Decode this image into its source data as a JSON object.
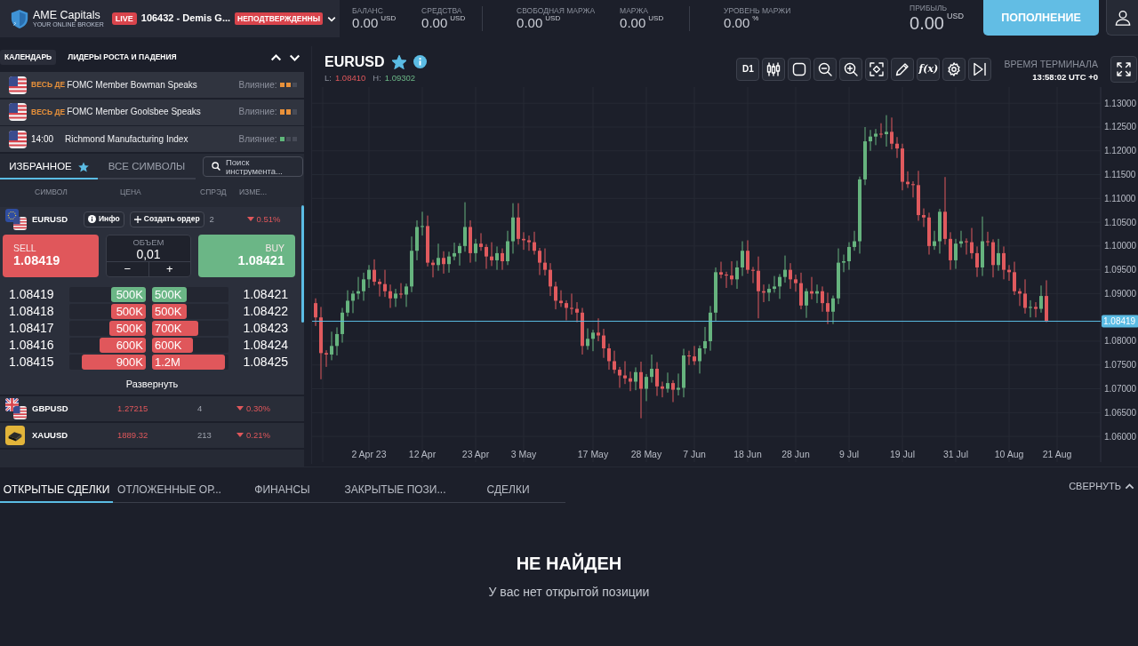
{
  "header": {
    "brand": "AME Capitals",
    "tagline": "YOUR ONLINE BROKER",
    "mode_badge": "LIVE",
    "account": "106432 - Demis G...",
    "status_badge": "НЕПОДТВЕРЖДЕННЫ"
  },
  "metrics": [
    {
      "kind": "stat",
      "label": "БАЛАНС",
      "value": "0.00",
      "unit": "USD"
    },
    {
      "kind": "stat",
      "label": "СРЕДСТВА",
      "value": "0.00",
      "unit": "USD"
    },
    {
      "kind": "stat",
      "label": "СВОБОДНАЯ МАРЖА",
      "value": "0.00",
      "unit": "USD"
    },
    {
      "kind": "stat",
      "label": "МАРЖА",
      "value": "0.00",
      "unit": "USD"
    },
    {
      "kind": "stat",
      "label": "УРОВЕНЬ МАРЖИ",
      "value": "0.00",
      "unit": "%"
    },
    {
      "kind": "total",
      "label": "ПРИБЫЛЬ",
      "value": "0.00",
      "unit": "USD"
    }
  ],
  "deposit_button": "ПОПОЛНЕНИЕ",
  "news_tabs": [
    {
      "label": "КАЛЕНДАРЬ",
      "selected": true
    },
    {
      "label": "ЛИДЕРЫ РОСТА И ПАДЕНИЯ",
      "selected": false
    }
  ],
  "calendar": [
    {
      "kind": "all_day",
      "time": "ВЕСЬ ДЕ",
      "title": "FOMC Member Bowman Speaks",
      "impact_label": "Влияние:",
      "stars": 2,
      "color": "#e8913a"
    },
    {
      "kind": "all_day",
      "time": "ВЕСЬ ДЕ",
      "title": "FOMC Member Goolsbee Speaks",
      "impact_label": "Влияние:",
      "stars": 2,
      "color": "#e8913a"
    },
    {
      "kind": "timed",
      "time": "14:00",
      "title": "Richmond Manufacturing Index",
      "impact_label": "Влияние:",
      "stars": 1,
      "color": "#5fb77a"
    }
  ],
  "symbol_tabs": [
    {
      "label": "ИЗБРАННОЕ",
      "selected": true
    },
    {
      "label": "ВСЕ СИМВОЛЫ",
      "selected": false
    }
  ],
  "search": {
    "placeholder": "Поиск инструмента..."
  },
  "columns": [
    "СИМВОЛ",
    "ЦЕНА",
    "СПРЭД",
    "ИЗМЕ..."
  ],
  "symbols": [
    {
      "symbol": "EURUSD",
      "expanded": true,
      "info_button": "Инфо",
      "order_button": "Создать ордер",
      "spread": "2",
      "change": "0.51%",
      "falling": true,
      "sell": {
        "label": "SELL",
        "price": "1.08419"
      },
      "volume": {
        "label": "ОБЪЕМ",
        "value": "0,01",
        "minus": "−",
        "plus": "+"
      },
      "buy": {
        "label": "BUY",
        "price": "1.08421"
      },
      "depth": [
        {
          "color": "#6bb686",
          "bid": {
            "price": "1.08419",
            "volume": "500K",
            "level": 0.45
          },
          "ask": {
            "price": "1.08421",
            "volume": "500K",
            "level": 0.45
          }
        },
        {
          "color": "#e0575b",
          "bid": {
            "price": "1.08418",
            "volume": "500K",
            "level": 0.45
          },
          "ask": {
            "price": "1.08422",
            "volume": "500K",
            "level": 0.45
          }
        },
        {
          "color": "#e0575b",
          "bid": {
            "price": "1.08417",
            "volume": "500K",
            "level": 0.48
          },
          "ask": {
            "price": "1.08423",
            "volume": "700K",
            "level": 0.6
          }
        },
        {
          "color": "#e0575b",
          "bid": {
            "price": "1.08416",
            "volume": "600K",
            "level": 0.6
          },
          "ask": {
            "price": "1.08424",
            "volume": "600K",
            "level": 0.54
          }
        },
        {
          "color": "#e0575b",
          "bid": {
            "price": "1.08415",
            "volume": "900K",
            "level": 0.84
          },
          "ask": {
            "price": "1.08425",
            "volume": "1.2M",
            "level": 0.95
          }
        }
      ],
      "expand_link": "Развернуть"
    },
    {
      "symbol": "GBPUSD",
      "expanded": false,
      "price": "1.27215",
      "spread": "4",
      "change": "0.30%",
      "falling": true
    },
    {
      "symbol": "XAUUSD",
      "expanded": false,
      "price": "1889.32",
      "spread": "213",
      "change": "0.21%",
      "falling": true
    }
  ],
  "chart": {
    "symbol": "EURUSD",
    "favorite": true,
    "low_label": "L:",
    "low": "1.08410",
    "high_label": "H:",
    "high": "1.09302",
    "timeframe": "D1",
    "indicator_button": "f(x)",
    "time_label": "ВРЕМЯ ТЕРМИНАЛА",
    "time": "13:58:02 UTC +0",
    "chart_data": {
      "type": "candlestick",
      "grid": true,
      "categories": [
        null,
        null,
        null,
        null,
        null,
        null,
        null,
        null,
        null,
        null,
        "2 Apr 23",
        null,
        null,
        null,
        null,
        null,
        null,
        null,
        null,
        null,
        "12 Apr",
        null,
        null,
        null,
        null,
        null,
        null,
        null,
        null,
        null,
        "23 Apr",
        null,
        null,
        null,
        null,
        null,
        null,
        null,
        null,
        "3 May",
        null,
        null,
        null,
        null,
        null,
        null,
        null,
        null,
        null,
        null,
        null,
        null,
        "17 May",
        null,
        null,
        null,
        null,
        null,
        null,
        null,
        null,
        null,
        "28 May",
        null,
        null,
        null,
        null,
        null,
        null,
        null,
        null,
        "7 Jun",
        null,
        null,
        null,
        null,
        null,
        null,
        null,
        null,
        null,
        "18 Jun",
        null,
        null,
        null,
        null,
        null,
        null,
        null,
        null,
        "28 Jun",
        null,
        null,
        null,
        null,
        null,
        null,
        null,
        null,
        null,
        "9 Jul",
        null,
        null,
        null,
        null,
        null,
        null,
        null,
        null,
        null,
        "19 Jul",
        null,
        null,
        null,
        null,
        null,
        null,
        null,
        null,
        null,
        "31 Jul",
        null,
        null,
        null,
        null,
        null,
        null,
        null,
        null,
        null,
        "10 Aug",
        null,
        null,
        null,
        null,
        null,
        null,
        null,
        null,
        "21 Aug"
      ],
      "ohlc": [
        [
          1.088,
          1.089,
          1.0832,
          1.085
        ],
        [
          1.085,
          1.0872,
          1.072,
          1.0775
        ],
        [
          1.0775,
          1.0781,
          1.0746,
          1.0772
        ],
        [
          1.0772,
          1.082,
          1.076,
          1.079
        ],
        [
          1.079,
          1.0829,
          1.077,
          1.0815
        ],
        [
          1.0815,
          1.087,
          1.0797,
          1.086
        ],
        [
          1.086,
          1.0907,
          1.0852,
          1.0885
        ],
        [
          1.0885,
          1.0906,
          1.0859,
          1.09
        ],
        [
          1.09,
          1.0935,
          1.0888,
          1.0905
        ],
        [
          1.0905,
          1.0944,
          1.0885,
          1.093
        ],
        [
          1.093,
          1.096,
          1.0912,
          1.095
        ],
        [
          1.095,
          1.0972,
          1.0917,
          1.0925
        ],
        [
          1.0925,
          1.0931,
          1.0894,
          1.092
        ],
        [
          1.092,
          1.095,
          1.0893,
          1.0905
        ],
        [
          1.0905,
          1.0919,
          1.087,
          1.089
        ],
        [
          1.089,
          1.091,
          1.0872,
          1.09
        ],
        [
          1.09,
          1.0922,
          1.089,
          1.0898
        ],
        [
          1.0898,
          1.0921,
          1.0872,
          1.0915
        ],
        [
          1.0915,
          1.102,
          1.0903,
          1.099
        ],
        [
          1.099,
          1.1054,
          1.097,
          1.104
        ],
        [
          1.104,
          1.1072,
          1.1022,
          1.1042
        ],
        [
          1.1042,
          1.1064,
          1.0957,
          1.0965
        ],
        [
          1.0965,
          1.0971,
          1.0934,
          1.096
        ],
        [
          1.096,
          1.1005,
          1.0948,
          1.0975
        ],
        [
          1.0975,
          1.0989,
          1.0942,
          1.0962
        ],
        [
          1.0962,
          1.0988,
          1.0944,
          1.0978
        ],
        [
          1.0978,
          1.1007,
          1.097,
          1.0985
        ],
        [
          1.0985,
          1.1006,
          1.0959,
          1.1
        ],
        [
          1.1,
          1.1092,
          1.0988,
          1.104
        ],
        [
          1.104,
          1.1054,
          1.0965,
          1.0985
        ],
        [
          1.0985,
          1.1015,
          1.0967,
          1.1005
        ],
        [
          1.1005,
          1.1027,
          1.099,
          1.0998
        ],
        [
          1.0998,
          1.1004,
          1.0952,
          1.0978
        ],
        [
          1.0978,
          1.1008,
          1.0958,
          1.097
        ],
        [
          1.097,
          1.0999,
          1.095,
          1.0985
        ],
        [
          1.0985,
          1.0995,
          1.095,
          1.0968
        ],
        [
          1.0968,
          1.1032,
          1.096,
          1.101
        ],
        [
          1.101,
          1.109,
          1.0984,
          1.106
        ],
        [
          1.106,
          1.109,
          1.1003,
          1.1015
        ],
        [
          1.1015,
          1.1029,
          1.0992,
          1.1012
        ],
        [
          1.1012,
          1.1022,
          1.099,
          1.1008
        ],
        [
          1.1008,
          1.103,
          1.0982,
          1.099
        ],
        [
          1.099,
          1.0996,
          1.0939,
          1.0965
        ],
        [
          1.0965,
          1.0995,
          1.0938,
          1.095
        ],
        [
          1.095,
          1.0964,
          1.0895,
          1.0915
        ],
        [
          1.0915,
          1.0925,
          1.0867,
          1.0885
        ],
        [
          1.0885,
          1.0907,
          1.0872,
          1.088
        ],
        [
          1.088,
          1.0886,
          1.0844,
          1.087
        ],
        [
          1.087,
          1.09,
          1.0856,
          1.0868
        ],
        [
          1.0868,
          1.0882,
          1.084,
          1.086
        ],
        [
          1.086,
          1.087,
          1.0772,
          1.079
        ],
        [
          1.079,
          1.0827,
          1.0782,
          1.0805
        ],
        [
          1.0805,
          1.0824,
          1.0779,
          1.0818
        ],
        [
          1.0818,
          1.0848,
          1.08,
          1.0812
        ],
        [
          1.0812,
          1.0826,
          1.0765,
          1.0785
        ],
        [
          1.0785,
          1.0795,
          1.074,
          1.0758
        ],
        [
          1.0758,
          1.078,
          1.0732,
          1.074
        ],
        [
          1.074,
          1.0746,
          1.0702,
          1.0728
        ],
        [
          1.0728,
          1.0758,
          1.071,
          1.0722
        ],
        [
          1.0722,
          1.0736,
          1.0695,
          1.0715
        ],
        [
          1.0715,
          1.0745,
          1.0697,
          1.0735
        ],
        [
          1.0735,
          1.0757,
          1.0638,
          1.07
        ],
        [
          1.07,
          1.0731,
          1.0674,
          1.0725
        ],
        [
          1.0725,
          1.0772,
          1.0713,
          1.0742
        ],
        [
          1.0742,
          1.0756,
          1.0685,
          1.0705
        ],
        [
          1.0705,
          1.0715,
          1.0682,
          1.07
        ],
        [
          1.07,
          1.0734,
          1.0692,
          1.0712
        ],
        [
          1.0712,
          1.0718,
          1.0672,
          1.0698
        ],
        [
          1.0698,
          1.0732,
          1.0686,
          1.0702
        ],
        [
          1.0702,
          1.0784,
          1.0682,
          1.077
        ],
        [
          1.077,
          1.078,
          1.075,
          1.0768
        ],
        [
          1.0768,
          1.079,
          1.075,
          1.0758
        ],
        [
          1.0758,
          1.0791,
          1.0732,
          1.0785
        ],
        [
          1.0785,
          1.083,
          1.0773,
          1.08
        ],
        [
          1.08,
          1.0874,
          1.078,
          1.086
        ],
        [
          1.086,
          1.0955,
          1.0842,
          1.0945
        ],
        [
          1.0945,
          1.0967,
          1.0932,
          1.094
        ],
        [
          1.094,
          1.0946,
          1.0912,
          1.0938
        ],
        [
          1.0938,
          1.0968,
          1.0918,
          1.093
        ],
        [
          1.093,
          1.0969,
          1.091,
          1.0955
        ],
        [
          1.0955,
          1.101,
          1.0937,
          1.099
        ],
        [
          1.099,
          1.1012,
          1.0942,
          1.095
        ],
        [
          1.095,
          1.0956,
          1.0922,
          1.0948
        ],
        [
          1.0948,
          1.0978,
          1.0848,
          1.0905
        ],
        [
          1.0905,
          1.0919,
          1.0882,
          1.0902
        ],
        [
          1.0902,
          1.092,
          1.0884,
          1.091
        ],
        [
          1.091,
          1.0937,
          1.0902,
          1.0915
        ],
        [
          1.0915,
          1.0941,
          1.0889,
          1.0935
        ],
        [
          1.0935,
          1.098,
          1.0923,
          1.095
        ],
        [
          1.095,
          1.0964,
          1.091,
          1.093
        ],
        [
          1.093,
          1.094,
          1.0904,
          1.0922
        ],
        [
          1.0922,
          1.0944,
          1.0867,
          1.0875
        ],
        [
          1.0875,
          1.0911,
          1.0849,
          1.0905
        ],
        [
          1.0905,
          1.0935,
          1.0888,
          1.09
        ],
        [
          1.09,
          1.0919,
          1.088,
          1.0905
        ],
        [
          1.0905,
          1.0915,
          1.0862,
          1.088
        ],
        [
          1.088,
          1.0902,
          1.0836,
          1.0862
        ],
        [
          1.0862,
          1.0896,
          1.0836,
          1.089
        ],
        [
          1.089,
          1.0995,
          1.0878,
          1.0965
        ],
        [
          1.0965,
          1.0982,
          1.0945,
          1.0968
        ],
        [
          1.0968,
          1.1008,
          1.095,
          1.0998
        ],
        [
          1.0998,
          1.1032,
          1.099,
          1.101
        ],
        [
          1.101,
          1.1146,
          1.0984,
          1.114
        ],
        [
          1.114,
          1.125,
          1.1128,
          1.122
        ],
        [
          1.122,
          1.1244,
          1.12,
          1.123
        ],
        [
          1.123,
          1.1246,
          1.1212,
          1.1236
        ],
        [
          1.1236,
          1.1258,
          1.1227,
          1.1235
        ],
        [
          1.1235,
          1.1275,
          1.1209,
          1.124
        ],
        [
          1.124,
          1.127,
          1.1203,
          1.1215
        ],
        [
          1.1215,
          1.1229,
          1.1185,
          1.1205
        ],
        [
          1.1205,
          1.1215,
          1.1117,
          1.1135
        ],
        [
          1.1135,
          1.1157,
          1.1122,
          1.113
        ],
        [
          1.113,
          1.1136,
          1.1102,
          1.1128
        ],
        [
          1.1128,
          1.1158,
          1.1053,
          1.1065
        ],
        [
          1.1065,
          1.1079,
          1.104,
          1.106
        ],
        [
          1.106,
          1.107,
          1.0982,
          1.1
        ],
        [
          1.1,
          1.1032,
          1.0992,
          1.101
        ],
        [
          1.101,
          1.1078,
          1.0984,
          1.1072
        ],
        [
          1.1072,
          1.1145,
          1.1003,
          1.1015
        ],
        [
          1.1015,
          1.1029,
          1.095,
          1.097
        ],
        [
          1.097,
          1.1015,
          1.0952,
          1.1005
        ],
        [
          1.1005,
          1.1032,
          1.0997,
          1.101
        ],
        [
          1.101,
          1.1016,
          1.0982,
          1.1008
        ],
        [
          1.1008,
          1.1038,
          1.0973,
          1.0985
        ],
        [
          1.0985,
          1.0999,
          1.0935,
          1.0955
        ],
        [
          1.0955,
          1.1062,
          1.0937,
          1.101
        ],
        [
          1.101,
          1.103,
          1.1,
          1.1008
        ],
        [
          1.1008,
          1.1014,
          1.0934,
          1.096
        ],
        [
          1.096,
          1.1015,
          1.0948,
          1.0985
        ],
        [
          1.0985,
          1.0999,
          1.093,
          1.095
        ],
        [
          1.095,
          1.096,
          1.0927,
          1.0945
        ],
        [
          1.0945,
          1.0967,
          1.0897,
          1.0905
        ],
        [
          1.0905,
          1.0911,
          1.0874,
          1.09
        ],
        [
          1.09,
          1.093,
          1.0858,
          1.087
        ],
        [
          1.087,
          1.0886,
          1.085,
          1.0872
        ],
        [
          1.0872,
          1.0882,
          1.085,
          1.0868
        ],
        [
          1.0868,
          1.0917,
          1.086,
          1.0895
        ],
        [
          1.0895,
          1.0928,
          1.084,
          1.0842
        ],
        null,
        null
      ],
      "ylim": [
        1.0546,
        1.1334
      ],
      "yticks": [
        {
          "value": 1.13,
          "label": "1.13000"
        },
        {
          "value": 1.125,
          "label": "1.12500"
        },
        {
          "value": 1.12,
          "label": "1.12000"
        },
        {
          "value": 1.115,
          "label": "1.11500"
        },
        {
          "value": 1.11,
          "label": "1.11000"
        },
        {
          "value": 1.105,
          "label": "1.10500"
        },
        {
          "value": 1.1,
          "label": "1.10000"
        },
        {
          "value": 1.095,
          "label": "1.09500"
        },
        {
          "value": 1.09,
          "label": "1.09000"
        },
        {
          "value": 1.08,
          "label": "1.08000"
        },
        {
          "value": 1.075,
          "label": "1.07500"
        },
        {
          "value": 1.07,
          "label": "1.07000"
        },
        {
          "value": 1.065,
          "label": "1.06500"
        },
        {
          "value": 1.06,
          "label": "1.06000"
        }
      ],
      "ref_lines": [
        {
          "axis": "y",
          "value": 1.08419,
          "label": "1.08419",
          "color": "#5bbce4"
        }
      ]
    }
  },
  "bottom_tabs": [
    {
      "label": "ОТКРЫТЫЕ СДЕЛКИ",
      "selected": true
    },
    {
      "label": "ОТЛОЖЕННЫЕ ОР...",
      "selected": false
    },
    {
      "label": "ФИНАНСЫ",
      "selected": false
    },
    {
      "label": "ЗАКРЫТЫЕ ПОЗИ...",
      "selected": false
    },
    {
      "label": "СДЕЛКИ",
      "selected": false
    }
  ],
  "collapse_button": "СВЕРНУТЬ",
  "empty_state": {
    "title": "НЕ НАЙДЕН",
    "message": "У вас нет открытой позиции"
  }
}
